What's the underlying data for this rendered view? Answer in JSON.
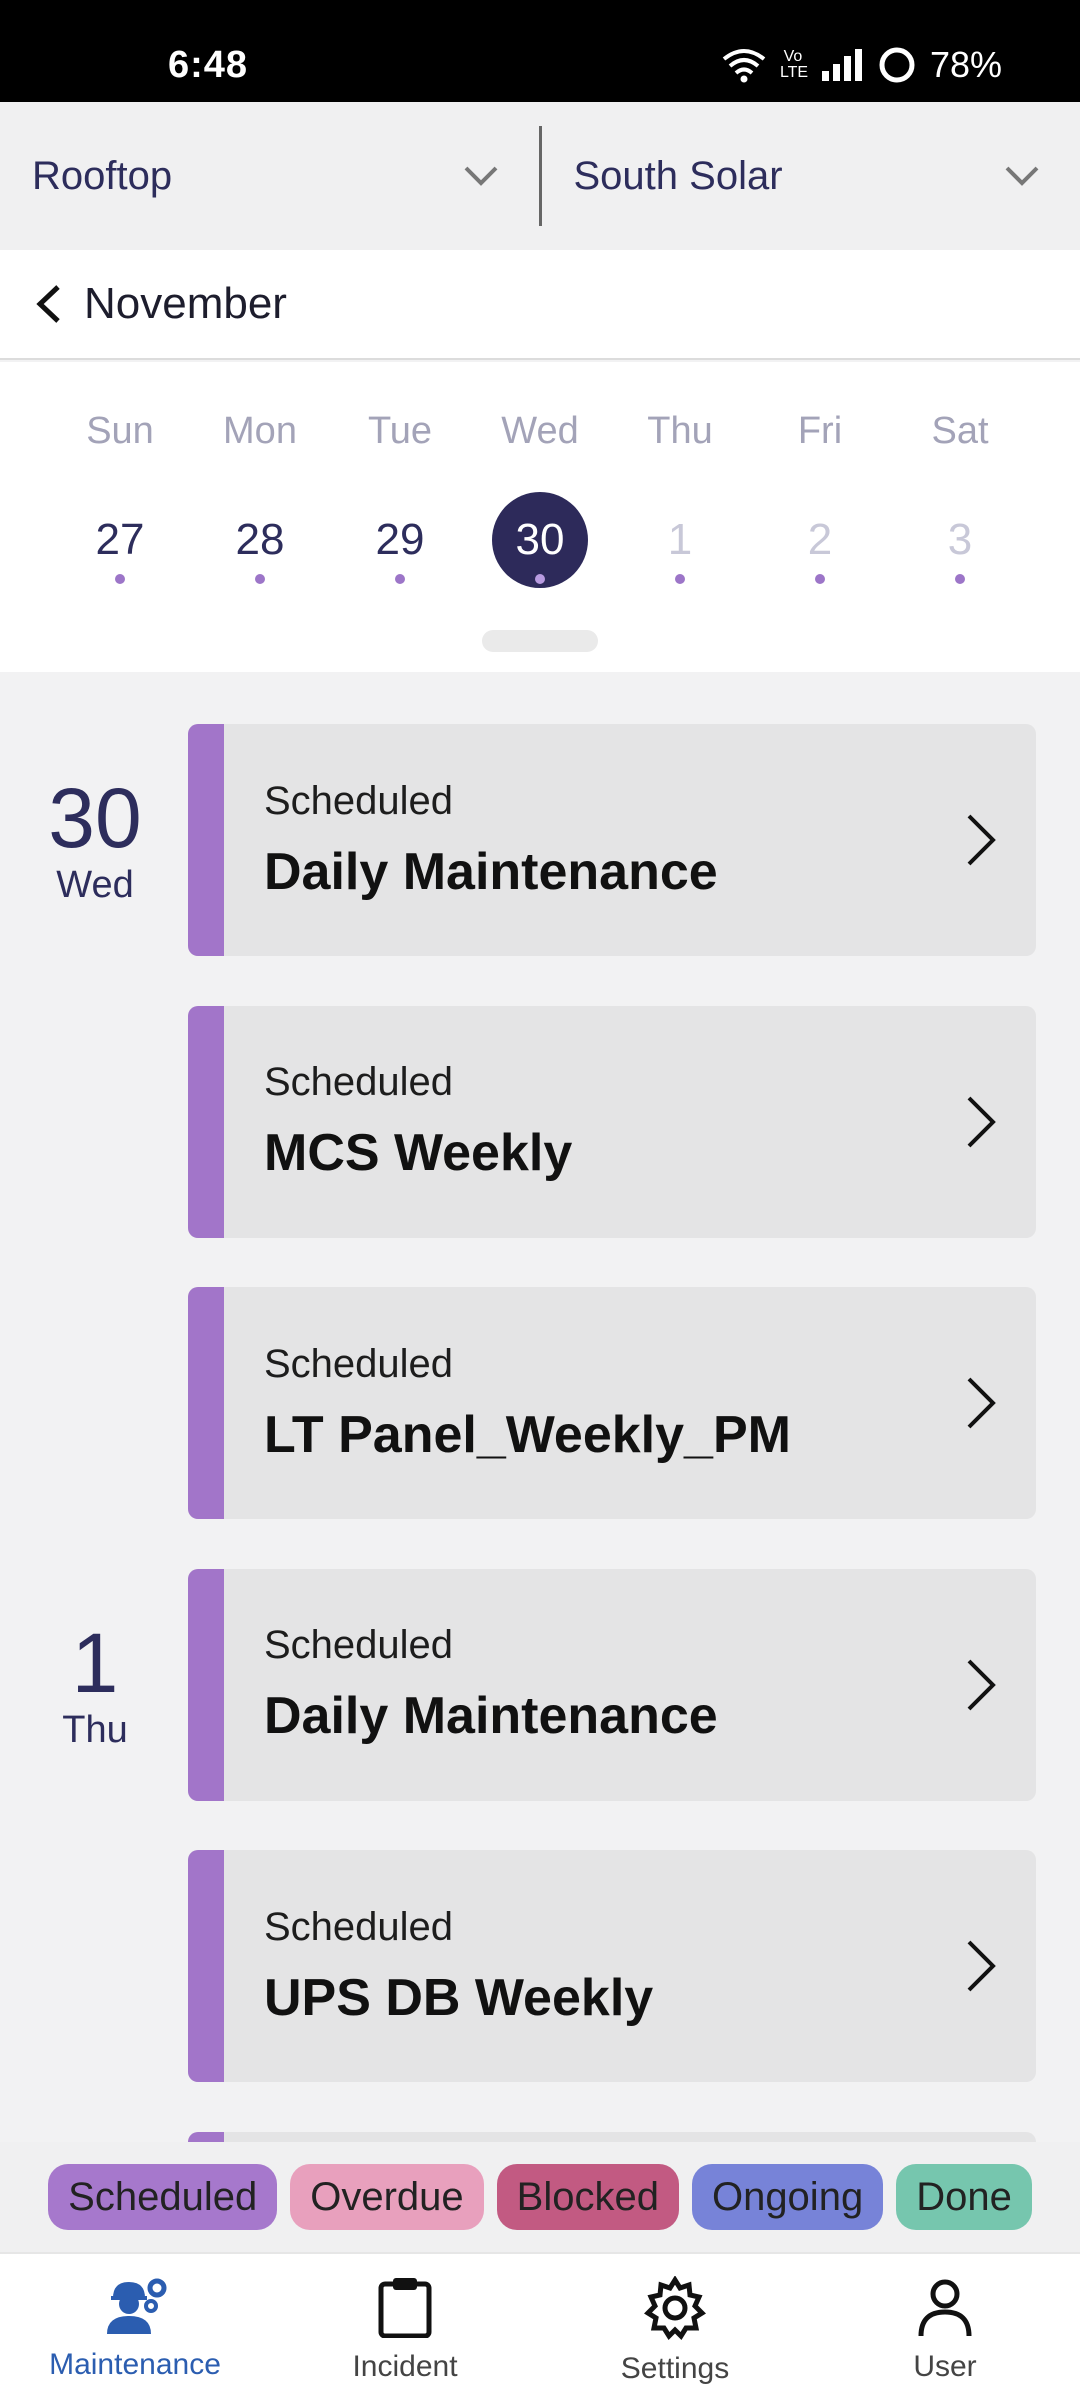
{
  "status_bar": {
    "time": "6:48",
    "battery": "78%",
    "network": "Vo LTE"
  },
  "site_selector": {
    "left": {
      "label": "Rooftop"
    },
    "right": {
      "label": "South Solar"
    }
  },
  "month_nav": {
    "label": "November"
  },
  "week": {
    "day_names": [
      "Sun",
      "Mon",
      "Tue",
      "Wed",
      "Thu",
      "Fri",
      "Sat"
    ],
    "dates": [
      "27",
      "28",
      "29",
      "30",
      "1",
      "2",
      "3"
    ],
    "selected_index": 3
  },
  "task_groups": [
    {
      "day_number": "30",
      "day_name": "Wed",
      "tasks": [
        {
          "status": "Scheduled",
          "title": "Daily Maintenance"
        },
        {
          "status": "Scheduled",
          "title": "MCS Weekly"
        },
        {
          "status": "Scheduled",
          "title": "LT Panel_Weekly_PM"
        }
      ]
    },
    {
      "day_number": "1",
      "day_name": "Thu",
      "tasks": [
        {
          "status": "Scheduled",
          "title": "Daily Maintenance"
        },
        {
          "status": "Scheduled",
          "title": "UPS DB Weekly"
        }
      ]
    }
  ],
  "legend": [
    {
      "label": "Scheduled",
      "color": "#a678cc"
    },
    {
      "label": "Overdue",
      "color": "#e8a0bd"
    },
    {
      "label": "Blocked",
      "color": "#c25a82"
    },
    {
      "label": "Ongoing",
      "color": "#7783d8"
    },
    {
      "label": "Done",
      "color": "#76c6ae"
    }
  ],
  "bottom_nav": [
    {
      "label": "Maintenance",
      "icon": "worker-gear-icon",
      "active": true
    },
    {
      "label": "Incident",
      "icon": "clipboard-icon",
      "active": false
    },
    {
      "label": "Settings",
      "icon": "gear-icon",
      "active": false
    },
    {
      "label": "User",
      "icon": "user-icon",
      "active": false
    }
  ],
  "colors": {
    "accent": "#a275c9",
    "primary_dark": "#2d2a5a",
    "nav_active": "#2b5db0"
  }
}
